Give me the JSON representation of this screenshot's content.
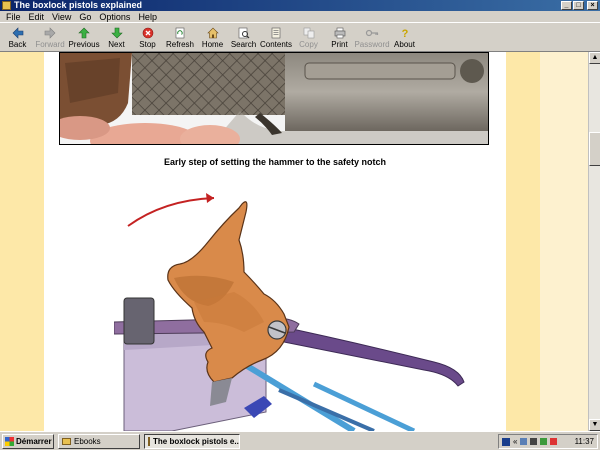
{
  "window": {
    "title": "The boxlock pistols explained"
  },
  "menu": [
    "File",
    "Edit",
    "View",
    "Go",
    "Options",
    "Help"
  ],
  "toolbar": {
    "back": "Back",
    "forward": "Forward",
    "previous": "Previous",
    "next": "Next",
    "stop": "Stop",
    "refresh": "Refresh",
    "home": "Home",
    "search": "Search",
    "contents": "Contents",
    "copy": "Copy",
    "print": "Print",
    "password": "Password",
    "about": "About"
  },
  "content": {
    "caption": "Early step of setting the hammer to the safety notch"
  },
  "taskbar": {
    "start": "Démarrer",
    "tasks": [
      "Ebooks",
      "The boxlock pistols e..."
    ],
    "tray_label": "«",
    "clock": "11:37"
  },
  "colors": {
    "page_band": "#fde8a8",
    "page_bg": "#fdf1cf",
    "titlebar": "#0a246a"
  }
}
